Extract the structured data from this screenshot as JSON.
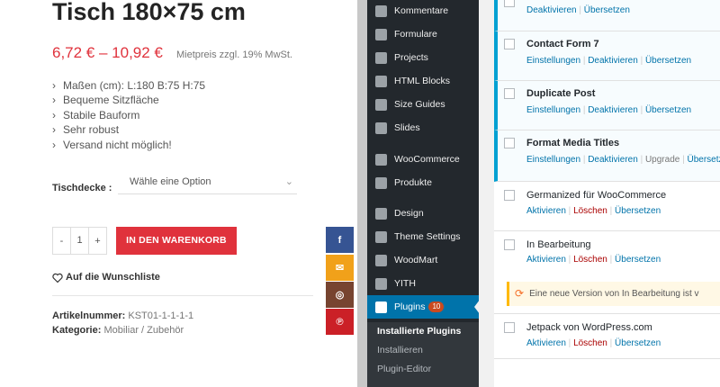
{
  "product": {
    "title": "Tisch 180×75 cm",
    "price": "6,72 € – 10,92 €",
    "tax_note": "Mietpreis zzgl. 19% MwSt.",
    "features": [
      "Maßen (cm): L:180 B:75 H:75",
      "Bequeme Sitzfläche",
      "Stabile Bauform",
      "Sehr robust",
      "Versand nicht möglich!"
    ],
    "variation_label": "Tischdecke",
    "variation_colon": ":",
    "select_placeholder": "Wähle eine Option",
    "qty_minus": "-",
    "qty_value": "1",
    "qty_plus": "+",
    "cart_button": "IN DEN WARENKORB",
    "wishlist": "Auf die Wunschliste",
    "sku_label": "Artikelnummer:",
    "sku_value": "KST01-1-1-1-1",
    "cat_label": "Kategorie:",
    "cat_value": "Mobiliar / Zubehör",
    "accent_color": "#e0323c"
  },
  "social": {
    "facebook": "f",
    "email": "✉",
    "instagram": "◎",
    "pinterest": "℗",
    "colors": {
      "facebook": "#365493",
      "email": "#f1a11a",
      "instagram": "#774430",
      "pinterest": "#cb2027"
    }
  },
  "wp_menu": {
    "items": [
      "Kommentare",
      "Formulare",
      "Projects",
      "HTML Blocks",
      "Size Guides",
      "Slides",
      "WooCommerce",
      "Produkte",
      "Design",
      "Theme Settings",
      "WoodMart",
      "YITH",
      "Plugins"
    ],
    "plugins_badge": "10",
    "submenu": [
      "Installierte Plugins",
      "Installieren",
      "Plugin-Editor"
    ]
  },
  "plugins": [
    {
      "name": "",
      "actions": [
        "Deaktivieren",
        "Übersetzen"
      ],
      "active": true
    },
    {
      "name": "Contact Form 7",
      "actions": [
        "Einstellungen",
        "Deaktivieren",
        "Übersetzen"
      ],
      "active": true
    },
    {
      "name": "Duplicate Post",
      "actions": [
        "Einstellungen",
        "Deaktivieren",
        "Übersetzen"
      ],
      "active": true
    },
    {
      "name": "Format Media Titles",
      "actions": [
        "Einstellungen",
        "Deaktivieren",
        "Upgrade",
        "Übersetzen"
      ],
      "active": true
    },
    {
      "name": "Germanized für WooCommerce",
      "actions": [
        "Aktivieren",
        "Löschen",
        "Übersetzen"
      ],
      "active": false
    },
    {
      "name": "In Bearbeitung",
      "actions": [
        "Aktivieren",
        "Löschen",
        "Übersetzen"
      ],
      "active": false
    },
    {
      "name": "Jetpack von WordPress.com",
      "actions": [
        "Aktivieren",
        "Löschen",
        "Übersetzen"
      ],
      "active": false
    }
  ],
  "update_notice": "Eine neue Version von In Bearbeitung ist v"
}
